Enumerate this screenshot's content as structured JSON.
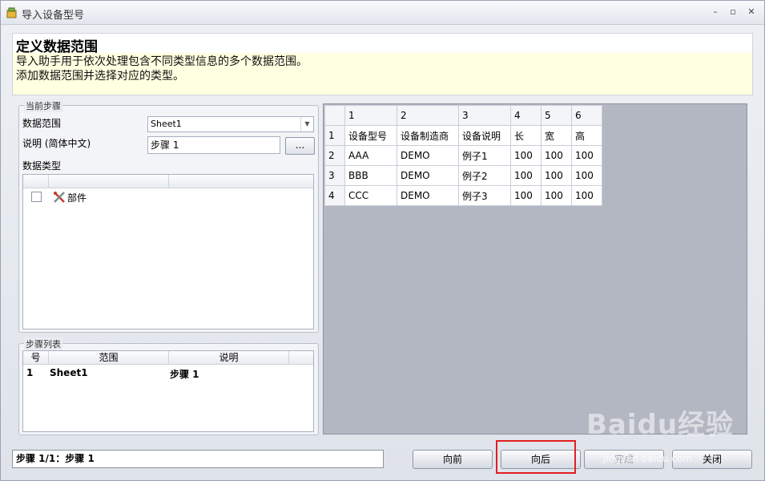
{
  "window": {
    "title": "导入设备型号",
    "controls": {
      "minimize": "–",
      "maximize": "▫",
      "close": "✕"
    }
  },
  "header": {
    "title": "定义数据范围",
    "desc_line1": "导入助手用于依次处理包含不同类型信息的多个数据范围。",
    "desc_line2": "添加数据范围并选择对应的类型。"
  },
  "current_step": {
    "group_label": "当前步骤",
    "range_label": "数据范围",
    "range_value": "Sheet1",
    "desc_label": "说明 (简体中文)",
    "desc_value": "步骤 1",
    "browse_label": "...",
    "type_label": "数据类型",
    "type_item": "部件"
  },
  "step_list": {
    "group_label": "步骤列表",
    "columns": [
      "号",
      "范围",
      "说明"
    ],
    "rows": [
      {
        "num": "1",
        "range": "Sheet1",
        "desc": "步骤 1"
      }
    ]
  },
  "grid": {
    "col_headers": [
      "1",
      "2",
      "3",
      "4",
      "5",
      "6"
    ],
    "rows": [
      {
        "num": "1",
        "cells": [
          "设备型号",
          "设备制造商",
          "设备说明",
          "长",
          "宽",
          "高"
        ]
      },
      {
        "num": "2",
        "cells": [
          "AAA",
          "DEMO",
          "例子1",
          "100",
          "100",
          "100"
        ]
      },
      {
        "num": "3",
        "cells": [
          "BBB",
          "DEMO",
          "例子2",
          "100",
          "100",
          "100"
        ]
      },
      {
        "num": "4",
        "cells": [
          "CCC",
          "DEMO",
          "例子3",
          "100",
          "100",
          "100"
        ]
      }
    ]
  },
  "footer": {
    "status": "步骤 1/1：步骤 1",
    "prev_label": "向前",
    "next_label": "向后",
    "finish_label": "完成",
    "close_label": "关闭"
  },
  "watermark": {
    "main": "Baidu经验",
    "sub": "jingyan.baidu.com"
  },
  "colors": {
    "highlight": "#e02020",
    "header_bg": "#ffffe1",
    "grid_bg": "#b3b7c2"
  }
}
